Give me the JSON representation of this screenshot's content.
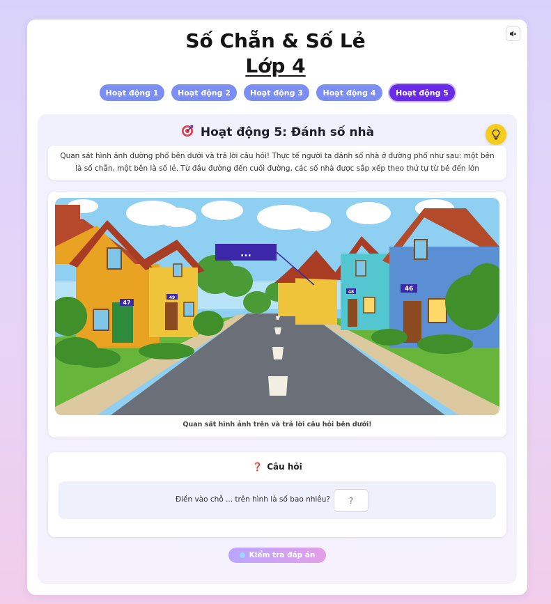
{
  "header": {
    "title": "Số Chẵn & Số Lẻ",
    "subtitle": "Lớp 4"
  },
  "tabs": [
    {
      "label": "Hoạt động 1",
      "active": false
    },
    {
      "label": "Hoạt động 2",
      "active": false
    },
    {
      "label": "Hoạt động 3",
      "active": false
    },
    {
      "label": "Hoạt động 4",
      "active": false
    },
    {
      "label": "Hoạt động 5",
      "active": true
    }
  ],
  "activity": {
    "title": "Hoạt động 5: Đánh số nhà",
    "intro": "Quan sát hình ảnh đường phố bên dưới và trả lời câu hỏi! Thực tế người ta đánh số nhà ở đường phố như sau: một bên là số chẵn, một bên là số lẻ. Từ đầu đường đến cuối đường, các số nhà được sắp xếp theo thứ tự từ bé đến lớn",
    "image_caption": "Quan sát hình ảnh trên và trả lời câu hỏi bên dưới!",
    "scene": {
      "callout_text": "...",
      "house_numbers": {
        "left_front": "47",
        "left_second": "49",
        "right_front": "46",
        "right_second": "48"
      }
    }
  },
  "question": {
    "heading": "Câu hỏi",
    "text": "Điền vào chỗ ... trên hình là số bao nhiêu?",
    "answer_placeholder": "?"
  },
  "actions": {
    "check_label": "Kiểm tra đáp án"
  },
  "colors": {
    "tab": "#7b8ef3",
    "tab_active": "#6a2be8",
    "bulb": "#f6cd1c",
    "callout": "#3b27a8"
  }
}
